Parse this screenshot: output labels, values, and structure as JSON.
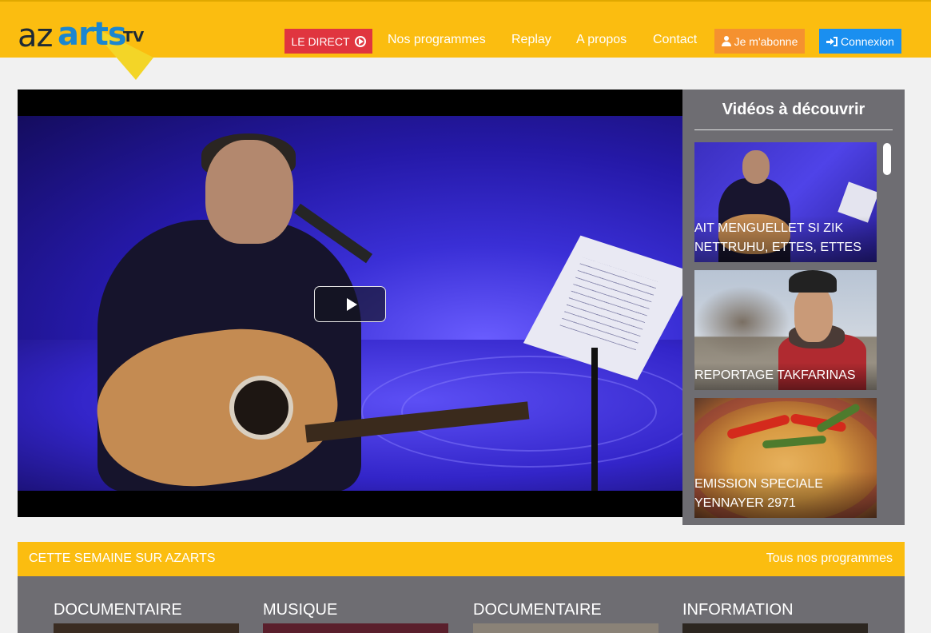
{
  "header": {
    "logo": {
      "az": "az",
      "arts": "arts",
      "tv": "TV"
    },
    "direct_label": "LE DIRECT",
    "nav": [
      "Nos programmes",
      "Replay",
      "A propos",
      "Contact"
    ],
    "subscribe_label": "Je m'abonne",
    "login_label": "Connexion"
  },
  "colors": {
    "header_bg": "#fbbd10",
    "direct_red": "#e0353f",
    "subscribe_orange": "#f5912f",
    "login_blue": "#1a8ff0",
    "panel_grey": "#6e6d72"
  },
  "side": {
    "title": "Vidéos à découvrir",
    "videos": [
      {
        "title": "AIT MENGUELLET SI ZIK NETTRUHU, ETTES, ETTES"
      },
      {
        "title": "REPORTAGE TAKFARINAS"
      },
      {
        "title": "EMISSION SPECIALE YENNAYER 2971"
      }
    ]
  },
  "week": {
    "title": "CETTE SEMAINE SUR AZARTS",
    "all_link": "Tous nos programmes",
    "categories": [
      "DOCUMENTAIRE",
      "MUSIQUE",
      "DOCUMENTAIRE",
      "INFORMATION"
    ]
  },
  "icons": {
    "play": "play-icon",
    "user": "user-icon",
    "login": "sign-in-icon",
    "direct": "play-circle-icon"
  }
}
